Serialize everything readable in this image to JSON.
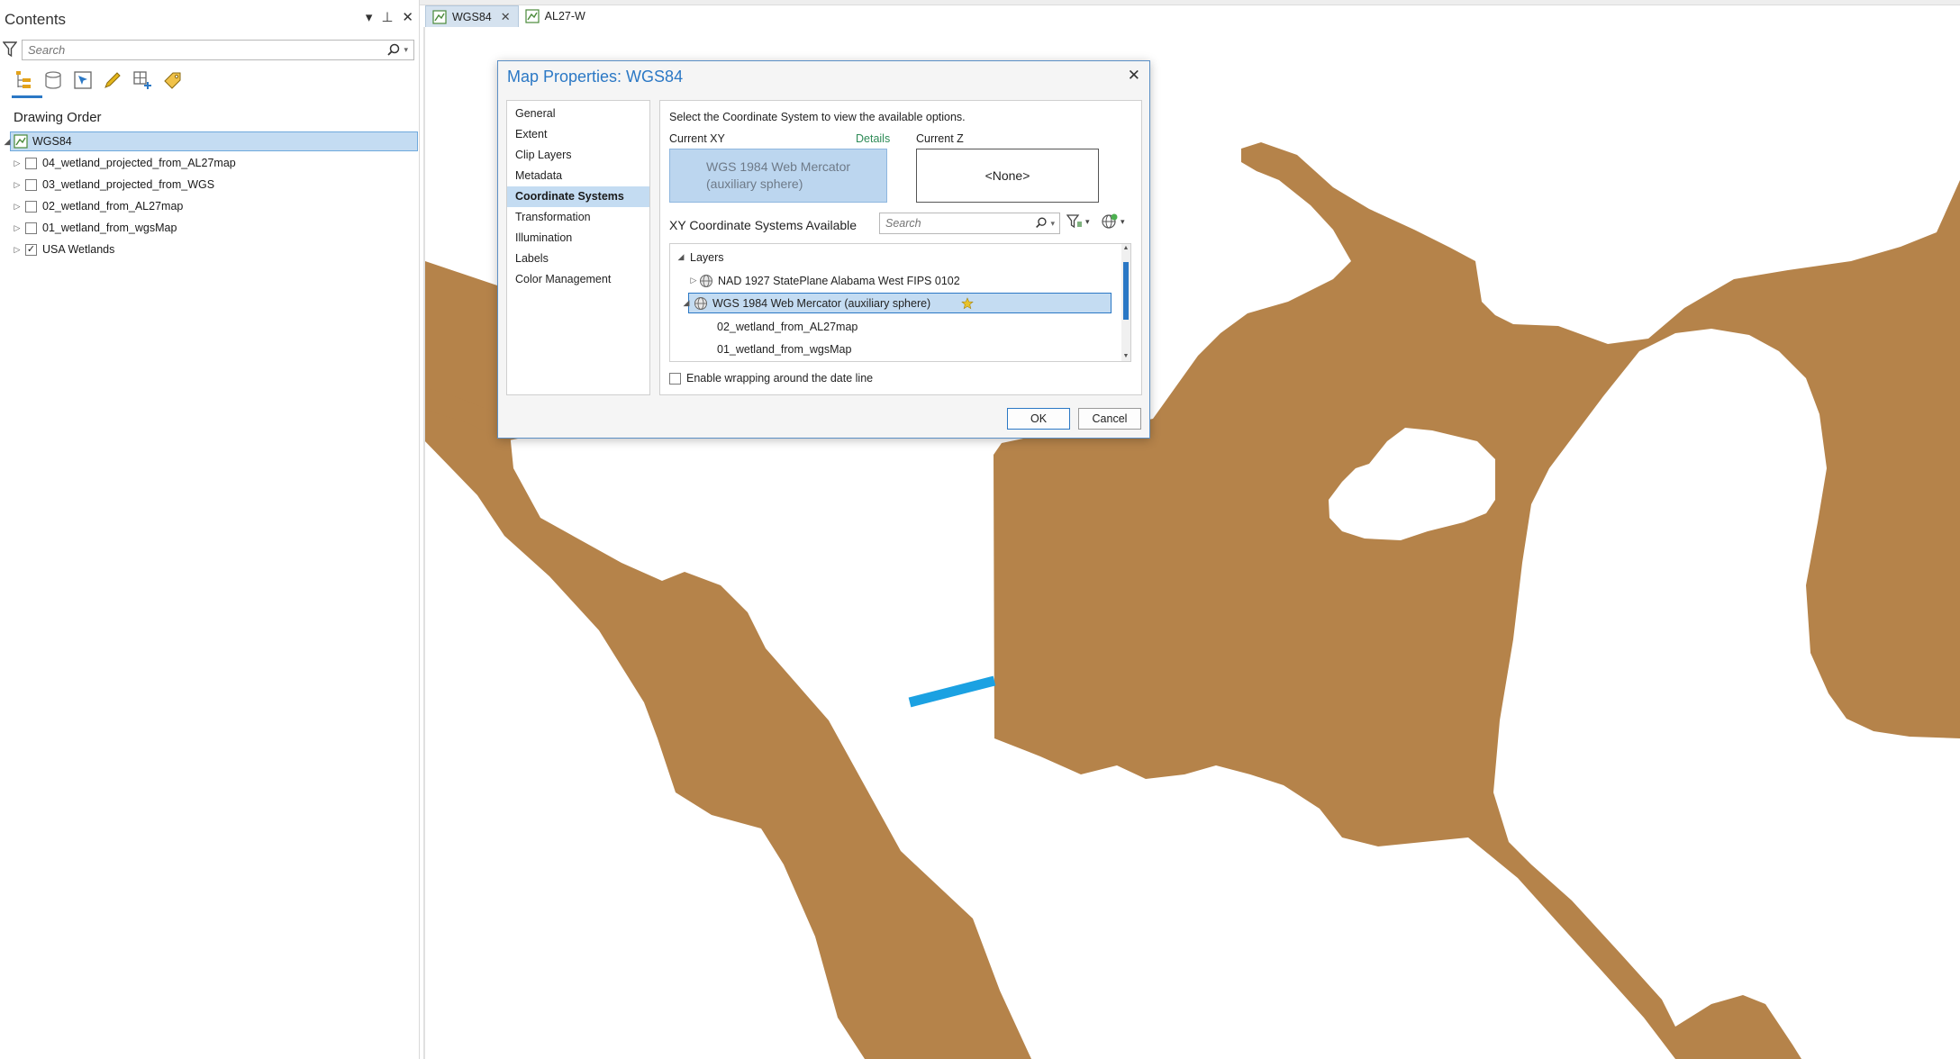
{
  "contents": {
    "title": "Contents",
    "controls": {
      "menu": "▾",
      "pin": "⊥",
      "close": "✕"
    },
    "search_placeholder": "Search",
    "tools": [
      "list-by-drawing-order-icon",
      "list-by-data-source-icon",
      "list-by-selection-icon",
      "list-by-editing-icon",
      "list-by-snapping-icon",
      "list-by-labeling-icon"
    ],
    "section_label": "Drawing Order",
    "map_item": "WGS84",
    "layers": [
      {
        "name": "04_wetland_projected_from_AL27map",
        "checked": false
      },
      {
        "name": "03_wetland_projected_from_WGS",
        "checked": false
      },
      {
        "name": "02_wetland_from_AL27map",
        "checked": false
      },
      {
        "name": "01_wetland_from_wgsMap",
        "checked": false
      },
      {
        "name": "USA Wetlands",
        "checked": true
      }
    ]
  },
  "tabs": [
    {
      "label": "WGS84",
      "active": true,
      "close": "✕"
    },
    {
      "label": "AL27-W",
      "active": false
    }
  ],
  "map": {
    "polygon_fill": "#b5834a",
    "line_color": "#1ba1e2"
  },
  "dialog": {
    "title": "Map Properties: WGS84",
    "close": "✕",
    "nav": [
      "General",
      "Extent",
      "Clip Layers",
      "Metadata",
      "Coordinate Systems",
      "Transformation",
      "Illumination",
      "Labels",
      "Color Management"
    ],
    "selected_nav": "Coordinate Systems",
    "instruction": "Select the Coordinate System to view the available options.",
    "current_xy_label": "Current XY",
    "details_link": "Details",
    "current_z_label": "Current Z",
    "current_xy_line1": "WGS 1984 Web Mercator",
    "current_xy_line2": "(auxiliary sphere)",
    "current_z_value": "<None>",
    "available_label": "XY Coordinate Systems Available",
    "available_search_placeholder": "Search",
    "tree": {
      "root": "Layers",
      "items": [
        "NAD 1927 StatePlane Alabama West FIPS 0102",
        "WGS 1984 Web Mercator (auxiliary sphere)"
      ],
      "children": [
        "02_wetland_from_AL27map",
        "01_wetland_from_wgsMap"
      ]
    },
    "wrap_label": "Enable wrapping around the date line",
    "ok_label": "OK",
    "cancel_label": "Cancel"
  }
}
